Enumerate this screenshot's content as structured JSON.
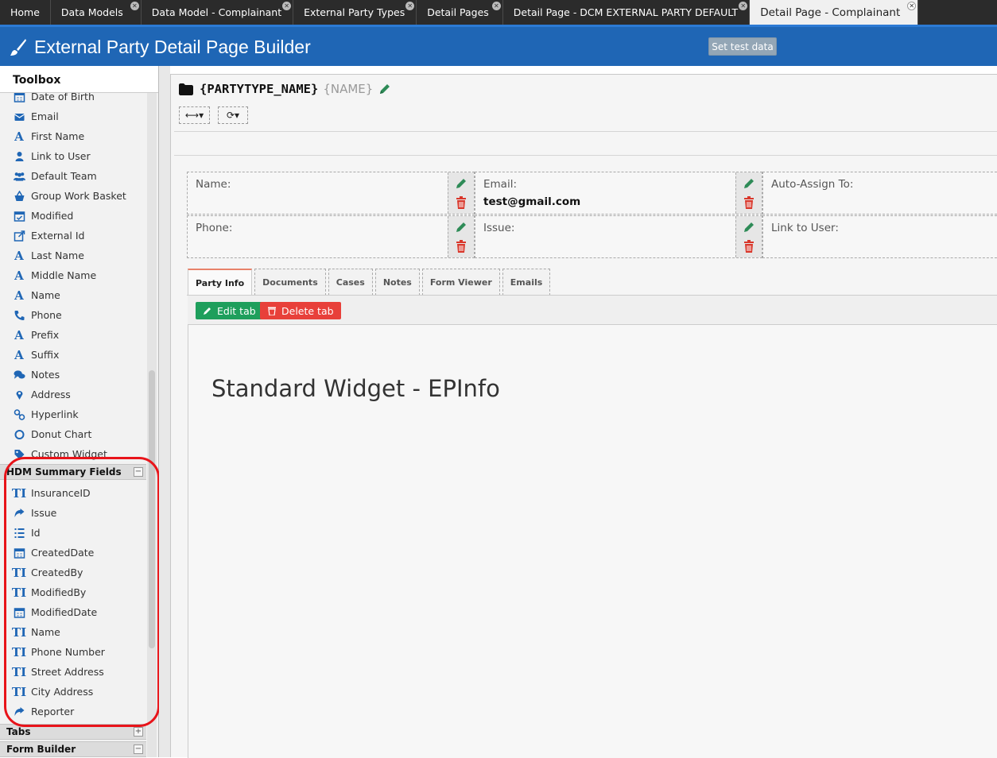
{
  "top_tabs": [
    {
      "label": "Home",
      "closable": false
    },
    {
      "label": "Data Models",
      "closable": true
    },
    {
      "label": "Data Model - Complainant",
      "closable": true
    },
    {
      "label": "External Party Types",
      "closable": true
    },
    {
      "label": "Detail Pages",
      "closable": true
    },
    {
      "label": "Detail Page - DCM EXTERNAL PARTY DEFAULT",
      "closable": true
    },
    {
      "label": "Detail Page - Complainant",
      "closable": true,
      "active": true
    }
  ],
  "header": {
    "title": "External Party Detail Page Builder",
    "set_test_data": "Set test data",
    "brand_color": "#1f66b5"
  },
  "toolbox": {
    "title": "Toolbox",
    "items": [
      {
        "label": "Date of Birth",
        "icon": "calendar-icon"
      },
      {
        "label": "Email",
        "icon": "envelope-icon"
      },
      {
        "label": "First Name",
        "icon": "letter-a-icon"
      },
      {
        "label": "Link to User",
        "icon": "user-icon"
      },
      {
        "label": "Default Team",
        "icon": "users-icon"
      },
      {
        "label": "Group Work Basket",
        "icon": "basket-icon"
      },
      {
        "label": "Modified",
        "icon": "calendar-check-icon"
      },
      {
        "label": "External Id",
        "icon": "external-link-icon"
      },
      {
        "label": "Last Name",
        "icon": "letter-a-icon"
      },
      {
        "label": "Middle Name",
        "icon": "letter-a-icon"
      },
      {
        "label": "Name",
        "icon": "letter-a-icon"
      },
      {
        "label": "Phone",
        "icon": "phone-icon"
      },
      {
        "label": "Prefix",
        "icon": "letter-a-icon"
      },
      {
        "label": "Suffix",
        "icon": "letter-a-icon"
      },
      {
        "label": "Notes",
        "icon": "comments-icon"
      },
      {
        "label": "Address",
        "icon": "map-marker-icon"
      },
      {
        "label": "Hyperlink",
        "icon": "link-icon"
      },
      {
        "label": "Donut Chart",
        "icon": "circle-icon"
      },
      {
        "label": "Custom Widget",
        "icon": "tag-icon"
      }
    ],
    "summary_section": {
      "title": "HDM Summary Fields",
      "toggle": "−",
      "items": [
        {
          "label": "InsuranceID",
          "icon": "text-type-icon"
        },
        {
          "label": "Issue",
          "icon": "share-arrow-icon"
        },
        {
          "label": "Id",
          "icon": "list-icon"
        },
        {
          "label": "CreatedDate",
          "icon": "calendar-icon"
        },
        {
          "label": "CreatedBy",
          "icon": "text-type-icon"
        },
        {
          "label": "ModifiedBy",
          "icon": "text-type-icon"
        },
        {
          "label": "ModifiedDate",
          "icon": "calendar-icon"
        },
        {
          "label": "Name",
          "icon": "text-type-icon"
        },
        {
          "label": "Phone Number",
          "icon": "text-type-icon"
        },
        {
          "label": "Street Address",
          "icon": "text-type-icon"
        },
        {
          "label": "City Address",
          "icon": "text-type-icon"
        },
        {
          "label": "Reporter",
          "icon": "share-arrow-icon"
        }
      ]
    },
    "tabs_section": {
      "title": "Tabs",
      "toggle": "+"
    },
    "form_builder_section": {
      "title": "Form Builder",
      "toggle": "−"
    }
  },
  "page": {
    "party_type": "{PARTYTYPE_NAME}",
    "name_token": "{NAME}",
    "fields": [
      {
        "label": "Name:",
        "value": ""
      },
      {
        "label": "Email:",
        "value": "test@gmail.com"
      },
      {
        "label": "Auto-Assign To:",
        "value": ""
      },
      {
        "label": "Phone:",
        "value": ""
      },
      {
        "label": "Issue:",
        "value": ""
      },
      {
        "label": "Link to User:",
        "value": ""
      }
    ],
    "tabs": [
      "Party Info",
      "Documents",
      "Cases",
      "Notes",
      "Form Viewer",
      "Emails"
    ],
    "edit_tab": "Edit tab",
    "delete_tab": "Delete tab",
    "widget_title": "Standard Widget - EPInfo"
  }
}
